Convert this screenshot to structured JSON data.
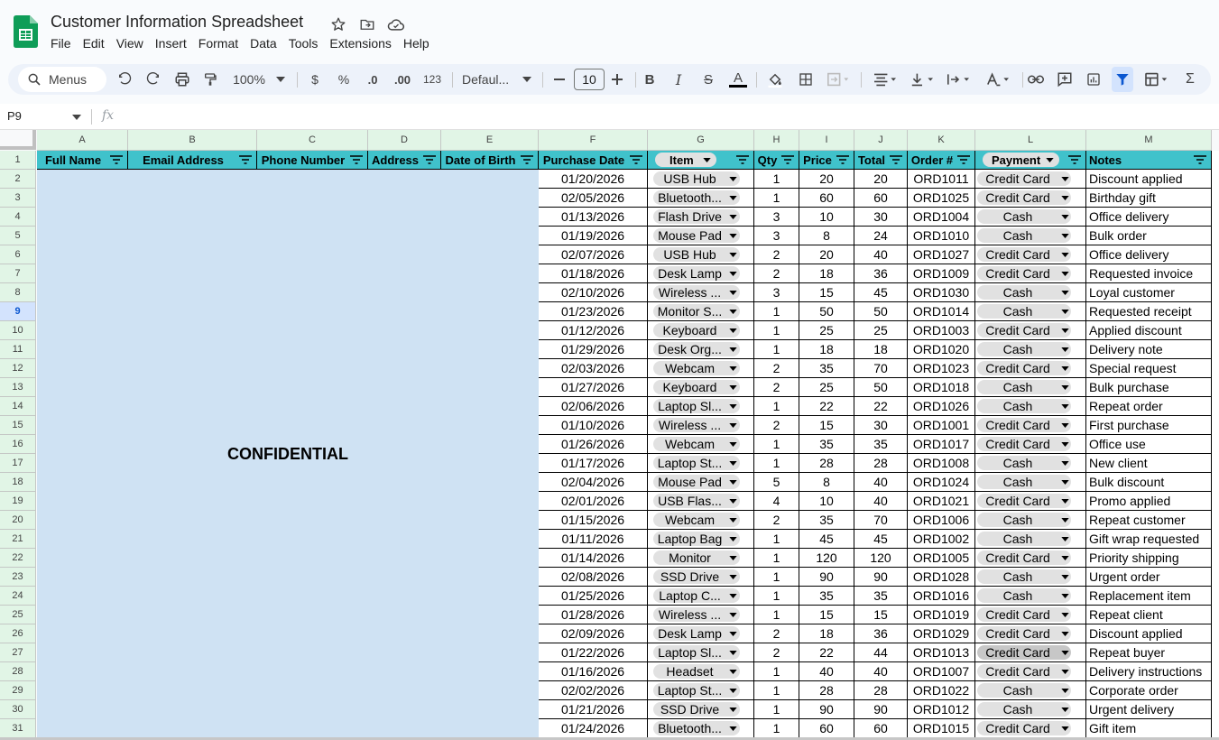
{
  "app": {
    "title": "Customer Information Spreadsheet",
    "menus": [
      "File",
      "Edit",
      "View",
      "Insert",
      "Format",
      "Data",
      "Tools",
      "Extensions",
      "Help"
    ]
  },
  "toolbar": {
    "search_label": "Menus",
    "zoom": "100%",
    "currency": "$",
    "percent": "%",
    "decrease_decimal": ".0",
    "increase_decimal": ".00",
    "number_format": "123",
    "font": "Defaul...",
    "font_size": "10",
    "bold": "B",
    "italic": "I",
    "strike": "S",
    "text_color": "A",
    "sum": "Σ"
  },
  "formula_bar": {
    "cell_ref": "P9",
    "fx": "fx",
    "value": ""
  },
  "columns": [
    "A",
    "B",
    "C",
    "D",
    "E",
    "F",
    "G",
    "H",
    "I",
    "J",
    "K",
    "L",
    "M"
  ],
  "headers": [
    "Full Name",
    "Email Address",
    "Phone Number",
    "Address",
    "Date of Birth",
    "Purchase Date",
    "Item",
    "Qty",
    "Price",
    "Total",
    "Order #",
    "Payment",
    "Notes"
  ],
  "confidential_label": "CONFIDENTIAL",
  "row_numbers": [
    "1",
    "2",
    "3",
    "4",
    "5",
    "6",
    "7",
    "8",
    "9",
    "10",
    "11",
    "12",
    "13",
    "14",
    "15",
    "16",
    "17",
    "18",
    "19",
    "20",
    "21",
    "22",
    "23",
    "24",
    "25",
    "26",
    "27",
    "28",
    "29",
    "30",
    "31"
  ],
  "selected_row": "9",
  "rows": [
    {
      "date": "01/20/2026",
      "item": "USB Hub",
      "qty": "1",
      "price": "20",
      "total": "20",
      "order": "ORD1011",
      "payment": "Credit Card",
      "notes": "Discount applied"
    },
    {
      "date": "02/05/2026",
      "item": "Bluetooth...",
      "qty": "1",
      "price": "60",
      "total": "60",
      "order": "ORD1025",
      "payment": "Credit Card",
      "notes": "Birthday gift"
    },
    {
      "date": "01/13/2026",
      "item": "Flash Drive",
      "qty": "3",
      "price": "10",
      "total": "30",
      "order": "ORD1004",
      "payment": "Cash",
      "notes": "Office delivery"
    },
    {
      "date": "01/19/2026",
      "item": "Mouse Pad",
      "qty": "3",
      "price": "8",
      "total": "24",
      "order": "ORD1010",
      "payment": "Cash",
      "notes": "Bulk order"
    },
    {
      "date": "02/07/2026",
      "item": "USB Hub",
      "qty": "2",
      "price": "20",
      "total": "40",
      "order": "ORD1027",
      "payment": "Credit Card",
      "notes": "Office delivery"
    },
    {
      "date": "01/18/2026",
      "item": "Desk Lamp",
      "qty": "2",
      "price": "18",
      "total": "36",
      "order": "ORD1009",
      "payment": "Credit Card",
      "notes": "Requested invoice"
    },
    {
      "date": "02/10/2026",
      "item": "Wireless ...",
      "qty": "3",
      "price": "15",
      "total": "45",
      "order": "ORD1030",
      "payment": "Cash",
      "notes": "Loyal customer"
    },
    {
      "date": "01/23/2026",
      "item": "Monitor S...",
      "qty": "1",
      "price": "50",
      "total": "50",
      "order": "ORD1014",
      "payment": "Cash",
      "notes": "Requested receipt"
    },
    {
      "date": "01/12/2026",
      "item": "Keyboard",
      "qty": "1",
      "price": "25",
      "total": "25",
      "order": "ORD1003",
      "payment": "Credit Card",
      "notes": "Applied discount"
    },
    {
      "date": "01/29/2026",
      "item": "Desk Org...",
      "qty": "1",
      "price": "18",
      "total": "18",
      "order": "ORD1020",
      "payment": "Cash",
      "notes": "Delivery note"
    },
    {
      "date": "02/03/2026",
      "item": "Webcam",
      "qty": "2",
      "price": "35",
      "total": "70",
      "order": "ORD1023",
      "payment": "Credit Card",
      "notes": "Special request"
    },
    {
      "date": "01/27/2026",
      "item": "Keyboard",
      "qty": "2",
      "price": "25",
      "total": "50",
      "order": "ORD1018",
      "payment": "Cash",
      "notes": "Bulk purchase"
    },
    {
      "date": "02/06/2026",
      "item": "Laptop Sl...",
      "qty": "1",
      "price": "22",
      "total": "22",
      "order": "ORD1026",
      "payment": "Cash",
      "notes": "Repeat order"
    },
    {
      "date": "01/10/2026",
      "item": "Wireless ...",
      "qty": "2",
      "price": "15",
      "total": "30",
      "order": "ORD1001",
      "payment": "Credit Card",
      "notes": "First purchase"
    },
    {
      "date": "01/26/2026",
      "item": "Webcam",
      "qty": "1",
      "price": "35",
      "total": "35",
      "order": "ORD1017",
      "payment": "Credit Card",
      "notes": "Office use"
    },
    {
      "date": "01/17/2026",
      "item": "Laptop St...",
      "qty": "1",
      "price": "28",
      "total": "28",
      "order": "ORD1008",
      "payment": "Cash",
      "notes": "New client"
    },
    {
      "date": "02/04/2026",
      "item": "Mouse Pad",
      "qty": "5",
      "price": "8",
      "total": "40",
      "order": "ORD1024",
      "payment": "Cash",
      "notes": "Bulk discount"
    },
    {
      "date": "02/01/2026",
      "item": "USB Flas...",
      "qty": "4",
      "price": "10",
      "total": "40",
      "order": "ORD1021",
      "payment": "Credit Card",
      "notes": "Promo applied"
    },
    {
      "date": "01/15/2026",
      "item": "Webcam",
      "qty": "2",
      "price": "35",
      "total": "70",
      "order": "ORD1006",
      "payment": "Cash",
      "notes": "Repeat customer"
    },
    {
      "date": "01/11/2026",
      "item": "Laptop Bag",
      "qty": "1",
      "price": "45",
      "total": "45",
      "order": "ORD1002",
      "payment": "Cash",
      "notes": "Gift wrap requested"
    },
    {
      "date": "01/14/2026",
      "item": "Monitor",
      "qty": "1",
      "price": "120",
      "total": "120",
      "order": "ORD1005",
      "payment": "Credit Card",
      "notes": "Priority shipping"
    },
    {
      "date": "02/08/2026",
      "item": "SSD Drive",
      "qty": "1",
      "price": "90",
      "total": "90",
      "order": "ORD1028",
      "payment": "Cash",
      "notes": "Urgent order"
    },
    {
      "date": "01/25/2026",
      "item": "Laptop C...",
      "qty": "1",
      "price": "35",
      "total": "35",
      "order": "ORD1016",
      "payment": "Cash",
      "notes": "Replacement item"
    },
    {
      "date": "01/28/2026",
      "item": "Wireless ...",
      "qty": "1",
      "price": "15",
      "total": "15",
      "order": "ORD1019",
      "payment": "Credit Card",
      "notes": "Repeat client"
    },
    {
      "date": "02/09/2026",
      "item": "Desk Lamp",
      "qty": "2",
      "price": "18",
      "total": "36",
      "order": "ORD1029",
      "payment": "Credit Card",
      "notes": "Discount applied"
    },
    {
      "date": "01/22/2026",
      "item": "Laptop Sl...",
      "qty": "2",
      "price": "22",
      "total": "44",
      "order": "ORD1013",
      "payment": "Credit Card",
      "notes": "Repeat buyer",
      "highlight": true
    },
    {
      "date": "01/16/2026",
      "item": "Headset",
      "qty": "1",
      "price": "40",
      "total": "40",
      "order": "ORD1007",
      "payment": "Credit Card",
      "notes": "Delivery instructions"
    },
    {
      "date": "02/02/2026",
      "item": "Laptop St...",
      "qty": "1",
      "price": "28",
      "total": "28",
      "order": "ORD1022",
      "payment": "Cash",
      "notes": "Corporate order"
    },
    {
      "date": "01/21/2026",
      "item": "SSD Drive",
      "qty": "1",
      "price": "90",
      "total": "90",
      "order": "ORD1012",
      "payment": "Cash",
      "notes": "Urgent delivery"
    },
    {
      "date": "01/24/2026",
      "item": "Bluetooth...",
      "qty": "1",
      "price": "60",
      "total": "60",
      "order": "ORD1015",
      "payment": "Credit Card",
      "notes": "Gift item"
    }
  ],
  "colors": {
    "header_fill": "#40c2cb",
    "confidential_fill": "#cfe2f3",
    "chip_fill": "#e1e1e1",
    "row_header_fill": "#e1f5e6"
  }
}
